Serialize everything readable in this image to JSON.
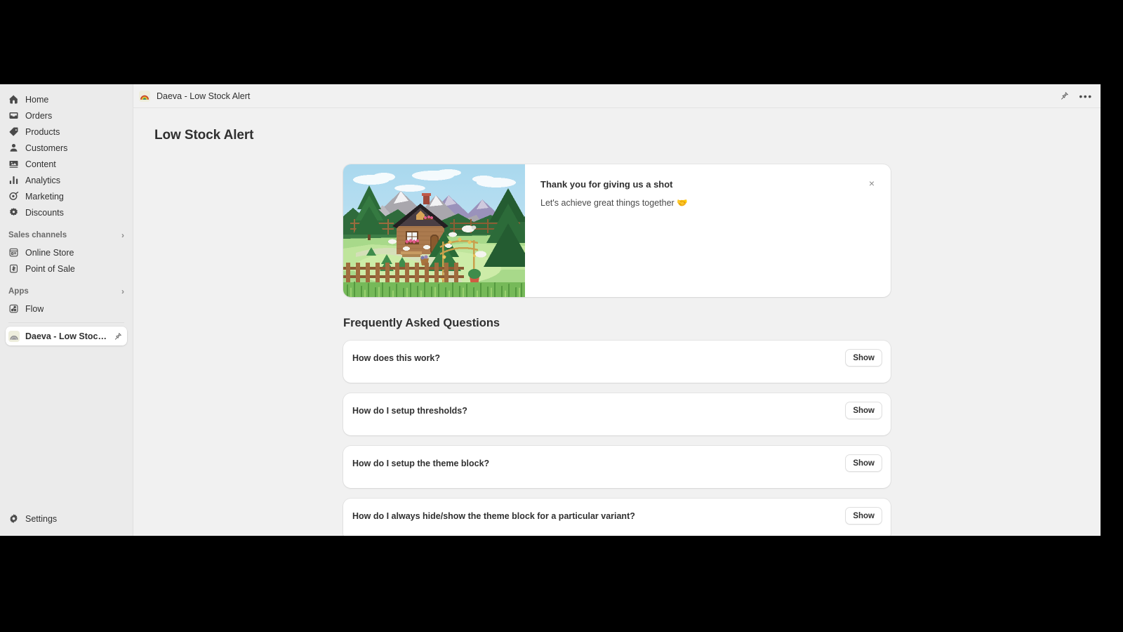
{
  "window": {
    "background_color": "#f1f1f1",
    "letterbox_color": "#000000"
  },
  "sidebar": {
    "background_color": "#ebebeb",
    "items": [
      {
        "label": "Home",
        "icon": "home-icon"
      },
      {
        "label": "Orders",
        "icon": "orders-inbox-icon"
      },
      {
        "label": "Products",
        "icon": "products-tag-icon"
      },
      {
        "label": "Customers",
        "icon": "customers-person-icon"
      },
      {
        "label": "Content",
        "icon": "content-image-icon"
      },
      {
        "label": "Analytics",
        "icon": "analytics-bar-chart-icon"
      },
      {
        "label": "Marketing",
        "icon": "marketing-target-icon"
      },
      {
        "label": "Discounts",
        "icon": "discounts-badge-icon"
      }
    ],
    "sales_channels": {
      "label": "Sales channels",
      "expand_icon": "chevron-right-icon",
      "items": [
        {
          "label": "Online Store",
          "icon": "storefront-icon"
        },
        {
          "label": "Point of Sale",
          "icon": "point-of-sale-icon"
        }
      ]
    },
    "apps": {
      "label": "Apps",
      "expand_icon": "chevron-right-icon",
      "items": [
        {
          "label": "Flow",
          "icon": "flow-icon"
        }
      ]
    },
    "active_app": {
      "label": "Daeva - Low Stock Al...",
      "icon": "daeva-rainbow-app-icon",
      "pin_icon": "pin-icon"
    },
    "settings": {
      "label": "Settings",
      "icon": "gear-icon"
    }
  },
  "topbar": {
    "app_icon": "daeva-rainbow-app-icon",
    "title": "Daeva - Low Stock Alert",
    "pin_icon": "pin-icon",
    "more_icon": "ellipsis-horizontal-icon"
  },
  "page": {
    "title": "Low Stock Alert"
  },
  "banner": {
    "image_alt": "pixel-art cabin in a forest meadow with mountains",
    "title": "Thank you for giving us a shot",
    "subtitle": "Let's achieve great things together 🤝",
    "close_icon": "close-icon",
    "close_label": "×"
  },
  "faq": {
    "heading": "Frequently Asked Questions",
    "items": [
      {
        "question": "How does this work?",
        "action": "Show"
      },
      {
        "question": "How do I setup thresholds?",
        "action": "Show"
      },
      {
        "question": "How do I setup the theme block?",
        "action": "Show"
      },
      {
        "question": "How do I always hide/show the theme block for a particular variant?",
        "action": "Show"
      }
    ]
  },
  "colors": {
    "page_bg": "#f1f1f1",
    "sidebar_bg": "#ebebeb",
    "card_bg": "#ffffff",
    "text_primary": "#303030",
    "text_secondary": "#6a6a6a",
    "border": "#e3e3e3"
  }
}
